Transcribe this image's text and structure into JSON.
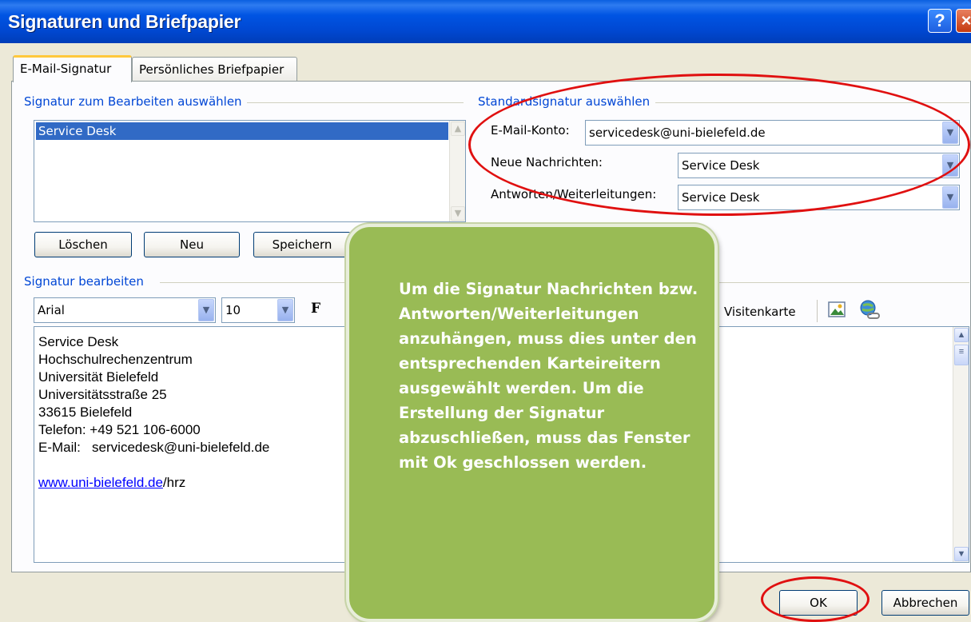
{
  "window": {
    "title": "Signaturen und Briefpapier",
    "help": "?",
    "close": "×"
  },
  "tabs": [
    "E-Mail-Signatur",
    "Persönliches Briefpapier"
  ],
  "select_group": {
    "label": "Signatur zum Bearbeiten auswählen",
    "items": [
      "Service Desk"
    ],
    "buttons": {
      "delete": "Löschen",
      "new": "Neu",
      "save": "Speichern"
    }
  },
  "default_group": {
    "label": "Standardsignatur auswählen",
    "account_label": "E-Mail-Konto:",
    "account_value": "servicedesk@uni-bielefeld.de",
    "new_label": "Neue Nachrichten:",
    "new_value": "Service Desk",
    "reply_label": "Antworten/Weiterleitungen:",
    "reply_value": "Service Desk"
  },
  "edit_group": {
    "label": "Signatur bearbeiten",
    "font": "Arial",
    "size": "10",
    "bold": "F",
    "business_card": "Visitenkarte",
    "signature_lines": [
      "Service Desk",
      "Hochschulrechenzentrum",
      "Universität Bielefeld",
      "Universitätsstraße 25",
      "33615 Bielefeld",
      "Telefon: +49 521 106-6000",
      "E-Mail:   servicedesk@uni-bielefeld.de"
    ],
    "link_text": "www.uni-bielefeld.de",
    "link_suffix": "/hrz"
  },
  "footer": {
    "ok": "OK",
    "cancel": "Abbrechen"
  },
  "overlay_text": "Um die Signatur Nachrichten bzw. Antworten/Weiterleitungen anzuhängen, muss dies unter den entsprechenden Karteireitern ausgewählt werden. Um die Erstellung der Signatur abzuschließen, muss das Fenster mit Ok geschlossen werden.",
  "colors": {
    "titlebar": "#0054E3",
    "group_label": "#0046D5",
    "selection": "#316AC5",
    "overlay": "#99BB55",
    "callout": "#E01010"
  }
}
